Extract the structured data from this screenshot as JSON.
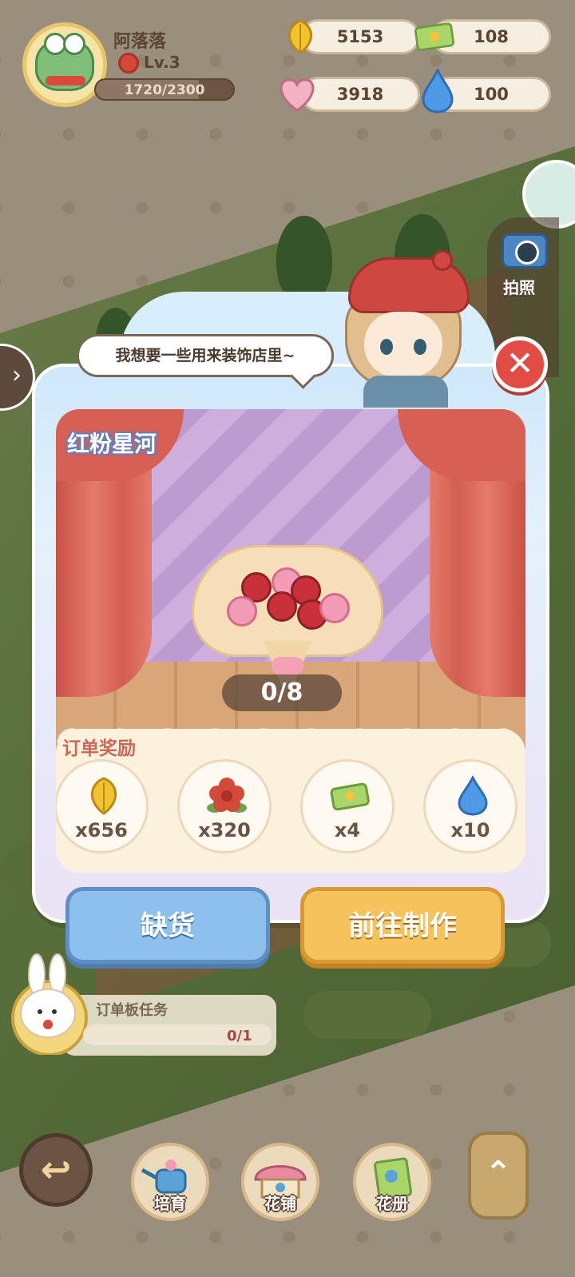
{
  "player": {
    "name": "阿落落",
    "level": "Lv.3",
    "xp_text": "1720/2300",
    "xp_fraction": 0.748
  },
  "resources": {
    "leaf": "5153",
    "ticket": "108",
    "heart": "3918",
    "water": "100"
  },
  "side": {
    "camera_label": "拍照"
  },
  "dialog": {
    "speech": "我想要一些用来装饰店里~",
    "order_name": "红粉星河",
    "progress": "0/8",
    "reward_title": "订单奖励",
    "rewards": [
      {
        "icon": "leaf-icon",
        "qty": "x656"
      },
      {
        "icon": "red-flower-icon",
        "qty": "x320"
      },
      {
        "icon": "ticket-icon",
        "qty": "x4"
      },
      {
        "icon": "water-drop-icon",
        "qty": "x10"
      }
    ],
    "shortage_label": "缺货",
    "make_label": "前往制作"
  },
  "task": {
    "label": "订单板任务",
    "count": "0/1"
  },
  "bottom_nav": {
    "cultivate": "培育",
    "flower_shop": "花铺",
    "flower_book": "花册"
  },
  "colors": {
    "accent_close": "#e24c44",
    "shortage_button": "#8ec0ee",
    "make_button": "#f6c25b"
  }
}
